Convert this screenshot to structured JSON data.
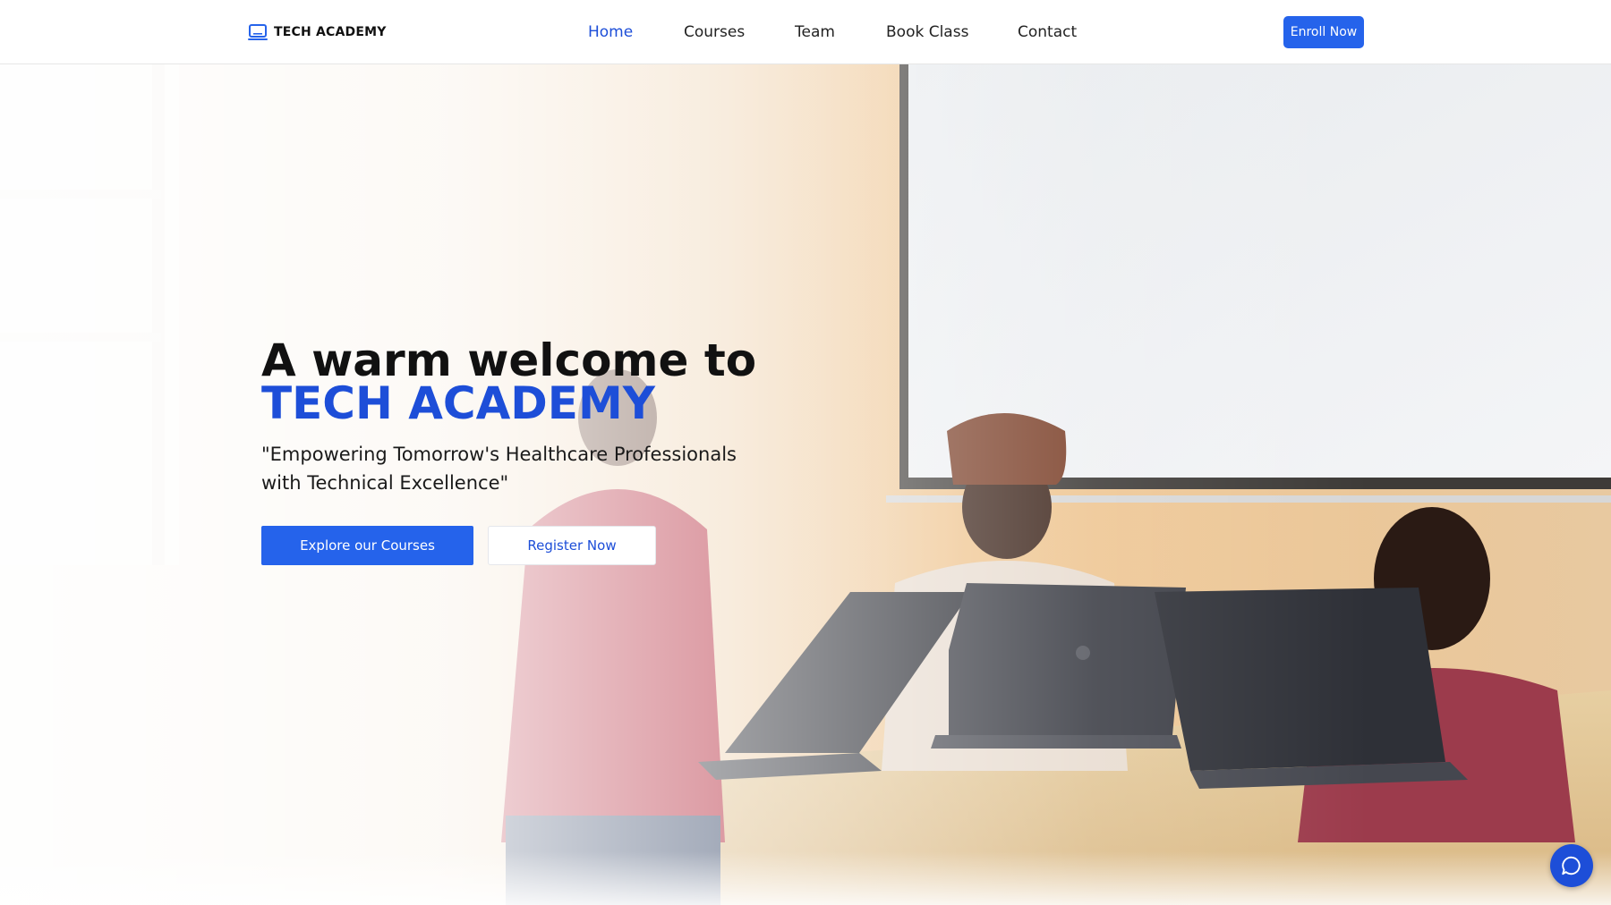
{
  "header": {
    "brand_name": "TECH ACADEMY",
    "brand_icon": "laptop-icon",
    "nav_items": [
      {
        "label": "Home",
        "active": true
      },
      {
        "label": "Courses",
        "active": false
      },
      {
        "label": "Team",
        "active": false
      },
      {
        "label": "Book Class",
        "active": false
      },
      {
        "label": "Contact",
        "active": false
      }
    ],
    "cta_label": "Enroll Now"
  },
  "hero": {
    "title_line1": "A warm welcome to",
    "title_line2": "TECH ACADEMY",
    "tagline": "\"Empowering Tomorrow's Healthcare Professionals with Technical Excellence\"",
    "primary_button": "Explore our Courses",
    "secondary_button": "Register Now",
    "background_image": "students-with-laptops-classroom-photo"
  },
  "chat_widget": {
    "icon": "chat-bubble-icon"
  },
  "colors": {
    "accent": "#2563eb",
    "brand_text": "#1d4ed8",
    "nav_active": "#1d4ed8"
  }
}
